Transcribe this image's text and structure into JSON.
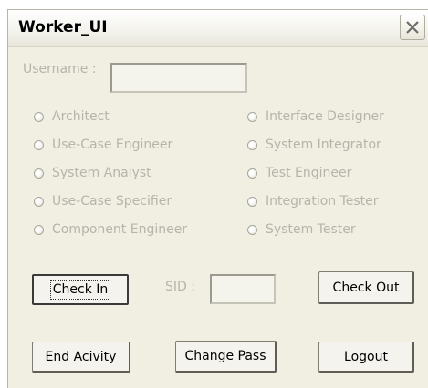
{
  "window": {
    "title": "Worker_UI"
  },
  "username": {
    "label": "Username :",
    "value": ""
  },
  "roles": [
    {
      "label": "Architect"
    },
    {
      "label": "Interface Designer"
    },
    {
      "label": "Use-Case Engineer"
    },
    {
      "label": "System Integrator"
    },
    {
      "label": "System Analyst"
    },
    {
      "label": "Test Engineer"
    },
    {
      "label": "Use-Case Specifier"
    },
    {
      "label": "Integration Tester"
    },
    {
      "label": "Component Engineer"
    },
    {
      "label": "System Tester"
    }
  ],
  "sid": {
    "label": "SID :",
    "value": ""
  },
  "buttons": {
    "check_in": "Check In",
    "check_out": "Check Out",
    "end_activity": "End Acivity",
    "change_pass": "Change Pass",
    "logout": "Logout"
  },
  "icons": {
    "close": "close-icon",
    "radio": "radio-icon"
  }
}
